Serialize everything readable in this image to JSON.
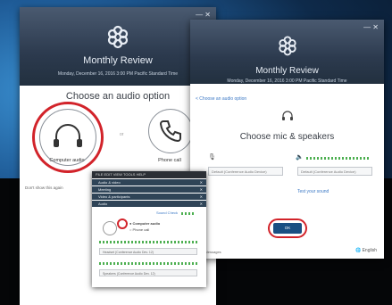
{
  "window_back": {
    "title": "Monthly Review",
    "subtitle": "Monday, December 16, 2016    3:00 PM Pacific Standard Time",
    "heading": "Choose an audio option",
    "computer_audio_label": "Computer audio",
    "phone_call_label": "Phone call",
    "footer_link": "Don't show this again"
  },
  "window_front": {
    "title": "Monthly Review",
    "subtitle": "Monday, December 16, 2016    3:00 PM Pacific Standard Time",
    "back_link": "< Choose an audio option",
    "heading": "Choose mic & speakers",
    "mic_value": "Default (Conference Audio Device)",
    "speaker_value": "Default (Conference Audio Device)",
    "test_link": "Test your sound",
    "ok_label": "OK",
    "footer_left": "Join Messages",
    "language": "English"
  },
  "audio_panel": {
    "menu": "FILE  EDIT  VIEW  TOOLS  HELP",
    "row1": "Audio & video",
    "row2": "Meeting",
    "row3": "Video & participants",
    "row4": "Audio",
    "sound_check": "Sound Check",
    "opt1": "Computer audio",
    "opt2": "Phone call",
    "mic": "Headset (Conference Audio Dev. 12)",
    "speaker": "Speakers (Conference Audio Dev. 12)"
  },
  "colors": {
    "accent_red": "#d2232a",
    "header": "#2c3a4e",
    "ok": "#1a4f82"
  }
}
